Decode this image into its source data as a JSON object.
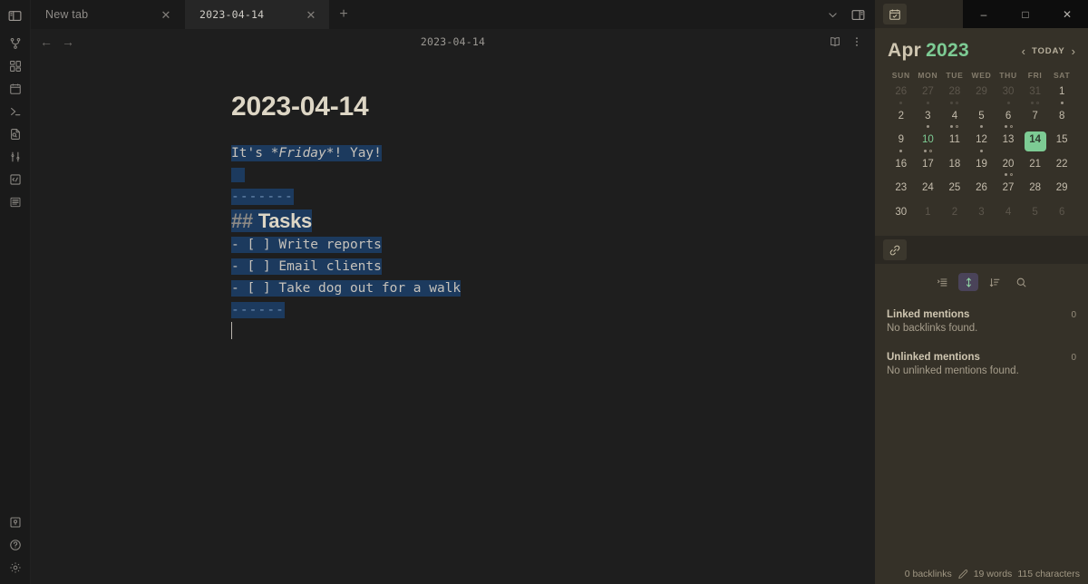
{
  "window": {
    "controls": {
      "minimize": "–",
      "maximize": "□",
      "close": "✕"
    }
  },
  "ribbon": {
    "toggle_sidebar_icon": "left-sidebar-toggle-icon",
    "items": [
      {
        "name": "git-icon",
        "label": "Git"
      },
      {
        "name": "dashboard-grid-icon",
        "label": "Dashboard"
      },
      {
        "name": "calendar-icon",
        "label": "Calendar"
      },
      {
        "name": "terminal-icon",
        "label": "Terminal"
      },
      {
        "name": "file-search-icon",
        "label": "File search"
      },
      {
        "name": "sliders-icon",
        "label": "Settings sliders"
      },
      {
        "name": "code-box-icon",
        "label": "Code"
      },
      {
        "name": "outline-list-icon",
        "label": "Outline"
      }
    ],
    "bottom_items": [
      {
        "name": "vault-icon",
        "label": "Open another vault"
      },
      {
        "name": "help-icon",
        "label": "Help"
      },
      {
        "name": "gear-icon",
        "label": "Settings"
      }
    ]
  },
  "tabs": [
    {
      "label": "New tab",
      "active": false,
      "close_glyph": "✕"
    },
    {
      "label": "2023-04-14",
      "active": true,
      "close_glyph": "✕"
    }
  ],
  "tabbar": {
    "new_tab_glyph": "+",
    "more_tabs_icon": "chevron-down-icon",
    "right_sidebar_toggle_icon": "right-sidebar-toggle-icon"
  },
  "view_header": {
    "back_glyph": "←",
    "forward_glyph": "→",
    "title": "2023-04-14",
    "reading_view_icon": "book-open-icon",
    "more_options_icon": "vertical-dots-icon"
  },
  "document": {
    "heading": "2023-04-14",
    "lines": [
      {
        "type": "text",
        "text": "It's *Friday*! Yay!",
        "selected": true
      },
      {
        "type": "blank",
        "text": "",
        "selected": true
      },
      {
        "type": "rule",
        "text": "-------",
        "selected": true
      },
      {
        "type": "h2",
        "hash": "## ",
        "text": "Tasks",
        "selected": true
      },
      {
        "type": "task",
        "text": "- [ ] Write reports",
        "selected": true
      },
      {
        "type": "task",
        "text": "- [ ] Email clients",
        "selected": true
      },
      {
        "type": "task",
        "text": "- [ ] Take dog out for a walk",
        "selected": true
      },
      {
        "type": "rule",
        "text": "------",
        "selected": true
      },
      {
        "type": "caret",
        "text": "",
        "selected": false
      }
    ],
    "inline": {
      "its": "It's ",
      "friday": "*Friday*",
      "yay": "! Yay!"
    }
  },
  "right_sidebar": {
    "tab_icon": "calendar-tab-icon",
    "calendar": {
      "month": "Apr",
      "year": "2023",
      "prev_glyph": "‹",
      "today_label": "TODAY",
      "next_glyph": "›",
      "weekdays": [
        "SUN",
        "MON",
        "TUE",
        "WED",
        "THU",
        "FRI",
        "SAT"
      ],
      "selected_day": 14,
      "accent_color": "#7dcb94",
      "weeks": [
        [
          {
            "n": "26",
            "adj": true,
            "dots": [
              "filled"
            ]
          },
          {
            "n": "27",
            "adj": true,
            "dots": [
              "filled"
            ]
          },
          {
            "n": "28",
            "adj": true,
            "dots": [
              "filled",
              "hollow"
            ]
          },
          {
            "n": "29",
            "adj": true,
            "dots": []
          },
          {
            "n": "30",
            "adj": true,
            "dots": [
              "filled"
            ]
          },
          {
            "n": "31",
            "adj": true,
            "dots": [
              "filled",
              "hollow"
            ]
          },
          {
            "n": "1",
            "adj": false,
            "dots": [
              "filled"
            ]
          }
        ],
        [
          {
            "n": "2",
            "adj": false,
            "dots": []
          },
          {
            "n": "3",
            "adj": false,
            "dots": [
              "filled"
            ]
          },
          {
            "n": "4",
            "adj": false,
            "dots": [
              "filled",
              "hollow"
            ]
          },
          {
            "n": "5",
            "adj": false,
            "dots": [
              "filled"
            ]
          },
          {
            "n": "6",
            "adj": false,
            "dots": [
              "filled",
              "hollow"
            ]
          },
          {
            "n": "7",
            "adj": false,
            "dots": []
          },
          {
            "n": "8",
            "adj": false,
            "dots": []
          }
        ],
        [
          {
            "n": "9",
            "adj": false,
            "dots": [
              "filled"
            ]
          },
          {
            "n": "10",
            "adj": false,
            "dots": [
              "filled",
              "hollow"
            ],
            "green": true
          },
          {
            "n": "11",
            "adj": false,
            "dots": []
          },
          {
            "n": "12",
            "adj": false,
            "dots": [
              "filled"
            ]
          },
          {
            "n": "13",
            "adj": false,
            "dots": []
          },
          {
            "n": "14",
            "adj": false,
            "dots": [],
            "selected": true
          },
          {
            "n": "15",
            "adj": false,
            "dots": []
          }
        ],
        [
          {
            "n": "16",
            "adj": false,
            "dots": []
          },
          {
            "n": "17",
            "adj": false,
            "dots": []
          },
          {
            "n": "18",
            "adj": false,
            "dots": []
          },
          {
            "n": "19",
            "adj": false,
            "dots": []
          },
          {
            "n": "20",
            "adj": false,
            "dots": [
              "filled",
              "hollow"
            ]
          },
          {
            "n": "21",
            "adj": false,
            "dots": []
          },
          {
            "n": "22",
            "adj": false,
            "dots": []
          }
        ],
        [
          {
            "n": "23",
            "adj": false,
            "dots": []
          },
          {
            "n": "24",
            "adj": false,
            "dots": []
          },
          {
            "n": "25",
            "adj": false,
            "dots": []
          },
          {
            "n": "26",
            "adj": false,
            "dots": []
          },
          {
            "n": "27",
            "adj": false,
            "dots": []
          },
          {
            "n": "28",
            "adj": false,
            "dots": []
          },
          {
            "n": "29",
            "adj": false,
            "dots": []
          }
        ],
        [
          {
            "n": "30",
            "adj": false,
            "dots": []
          },
          {
            "n": "1",
            "adj": true,
            "dots": []
          },
          {
            "n": "2",
            "adj": true,
            "dots": []
          },
          {
            "n": "3",
            "adj": true,
            "dots": []
          },
          {
            "n": "4",
            "adj": true,
            "dots": []
          },
          {
            "n": "5",
            "adj": true,
            "dots": []
          },
          {
            "n": "6",
            "adj": true,
            "dots": []
          }
        ]
      ]
    },
    "backlinks": {
      "tab_icon": "backlink-tab-icon",
      "tools": [
        {
          "name": "collapse-results-icon",
          "active": false
        },
        {
          "name": "expand-results-icon",
          "active": true
        },
        {
          "name": "sort-order-icon",
          "active": false
        },
        {
          "name": "search-icon",
          "active": false
        }
      ],
      "linked_label": "Linked mentions",
      "linked_count": "0",
      "linked_empty": "No backlinks found.",
      "unlinked_label": "Unlinked mentions",
      "unlinked_count": "0",
      "unlinked_empty": "No unlinked mentions found."
    },
    "status": {
      "backlinks": "0 backlinks",
      "pencil_icon": "pencil-icon",
      "words": "19 words",
      "characters": "115 characters"
    }
  }
}
